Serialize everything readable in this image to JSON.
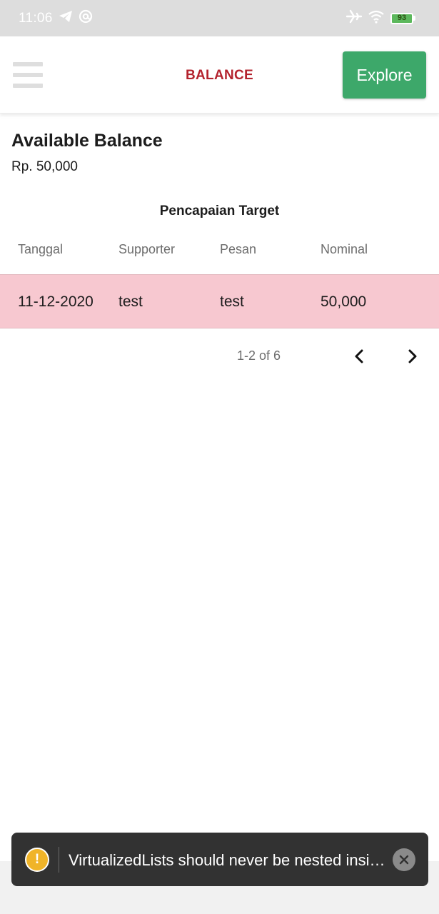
{
  "status_bar": {
    "time": "11:06",
    "battery": "93",
    "icons": [
      "telegram-icon",
      "at-sign-icon",
      "airplane-icon",
      "wifi-icon",
      "battery-icon"
    ]
  },
  "header": {
    "title": "BALANCE",
    "explore_label": "Explore",
    "title_color": "#b4232e",
    "explore_color": "#3da86a"
  },
  "balance": {
    "title": "Available Balance",
    "amount": "Rp. 50,000"
  },
  "table": {
    "title": "Pencapaian Target",
    "columns": [
      "Tanggal",
      "Supporter",
      "Pesan",
      "Nominal"
    ],
    "rows": [
      [
        "11-12-2020",
        "test",
        "test",
        "50,000"
      ]
    ],
    "row_color": "#f7c8d0"
  },
  "pagination": {
    "range": "1-2 of 6",
    "prev_icon": "chevron-left-icon",
    "next_icon": "chevron-right-icon"
  },
  "toast": {
    "message": "VirtualizedLists should never be nested insi…",
    "icon": "warning-icon",
    "warning_symbol": "!",
    "close_icon": "close-icon"
  }
}
